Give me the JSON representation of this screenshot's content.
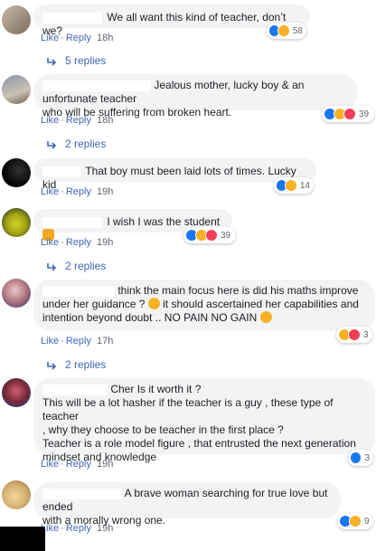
{
  "comments": [
    {
      "text": "We all want this kind of teacher, don’t we?",
      "like": "Like",
      "reply": "Reply",
      "time": "18h",
      "reactions": "58",
      "replies": "5 replies"
    },
    {
      "text": "Jealous mother, lucky boy & an unfortunate teacher",
      "text2": "who will be suffering from broken heart.",
      "like": "Like",
      "reply": "Reply",
      "time": "18h",
      "reactions": "39",
      "replies": "2 replies"
    },
    {
      "text": "That boy must been laid lots of times. Lucky kid",
      "like": "Like",
      "reply": "Reply",
      "time": "19h",
      "reactions": "14"
    },
    {
      "text": "I wish I was the student",
      "like": "Like",
      "reply": "Reply",
      "time": "19h",
      "reactions": "39",
      "replies": "2 replies"
    },
    {
      "text": "think the main focus here is did his maths improve",
      "text2": "under her guidance ?",
      "text2b": "it should ascertained her capabilities and",
      "text3": "intention beyond doubt .. NO PAIN NO GAIN",
      "like": "Like",
      "reply": "Reply",
      "time": "17h",
      "reactions": "3",
      "replies": "2 replies"
    },
    {
      "text": "Cher Is it worth it ?",
      "text2": "This will be a lot hasher if the teacher is a guy , these type of teacher",
      "text3": ", why they choose to be teacher in the first place ?",
      "text4": "Teacher is a role model figure , that entrusted the next generation",
      "text5": "mindset and knowledge",
      "like": "Like",
      "reply": "Reply",
      "time": "19h",
      "reactions": "3"
    },
    {
      "text": "A brave woman searching for true love but ended",
      "text2": "with a morally wrong one.",
      "like": "Like",
      "reply": "Reply",
      "time": "19h",
      "reactions": "9"
    }
  ],
  "colors": {
    "link": "#4267b2",
    "bubble": "#f2f3f5",
    "meta": "#606770",
    "like_icon": "#1877f2",
    "haha_icon": "#f7b125",
    "love_icon": "#f33e58"
  },
  "icons": [
    "reply-arrow-icon",
    "like-reaction-icon",
    "haha-reaction-icon",
    "love-reaction-icon",
    "sad-reaction-icon"
  ]
}
